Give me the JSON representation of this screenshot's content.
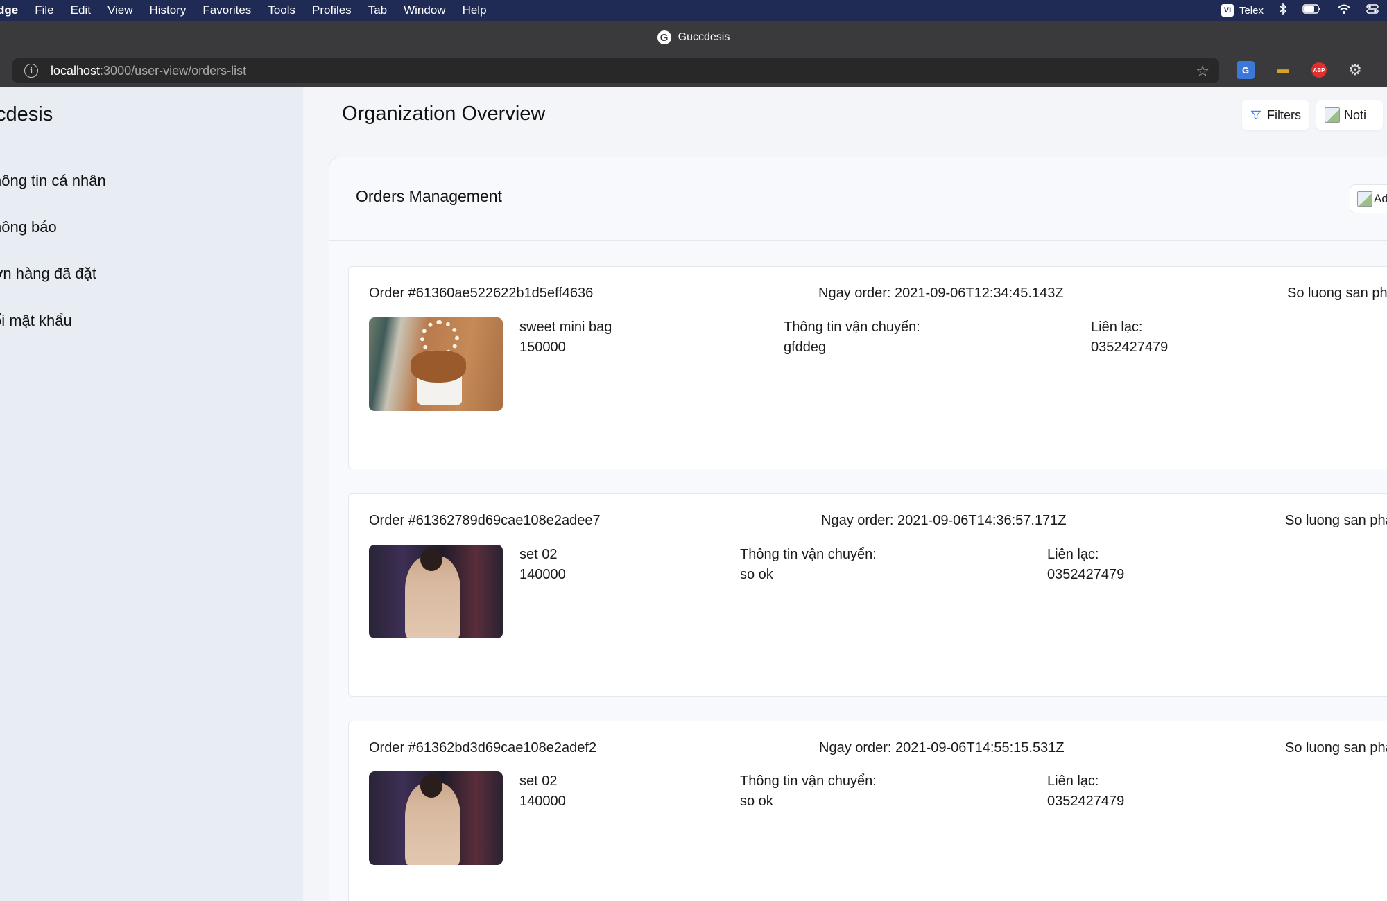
{
  "menubar": {
    "items": [
      "dge",
      "File",
      "Edit",
      "View",
      "History",
      "Favorites",
      "Tools",
      "Profiles",
      "Tab",
      "Window",
      "Help"
    ],
    "input_method": "Telex"
  },
  "browser": {
    "window_title": "Guccdesis",
    "url_host": "localhost",
    "url_path": ":3000/user-view/orders-list"
  },
  "sidebar": {
    "brand": "cdesis",
    "items": [
      {
        "label": "hông tin cá nhân"
      },
      {
        "label": "hông báo"
      },
      {
        "label": "ơn hàng đã đặt"
      },
      {
        "label": "ổi mật khẩu"
      }
    ]
  },
  "header": {
    "title": "Organization Overview",
    "filters_label": "Filters",
    "noti_label": "Noti"
  },
  "orders_panel": {
    "title": "Orders Management",
    "add_label": "Ad"
  },
  "orders": [
    {
      "id": "Order #61360ae522622b1d5eff4636",
      "date": "Ngay order: 2021-09-06T12:34:45.143Z",
      "qty_label": "So luong san pha",
      "product_name": "sweet mini bag",
      "price": "150000",
      "shipping_label": "Thông tin vận chuyển:",
      "shipping": "gfddeg",
      "contact_label": "Liên lạc:",
      "contact": "0352427479",
      "image": "handbag"
    },
    {
      "id": "Order #61362789d69cae108e2adee7",
      "date": "Ngay order: 2021-09-06T14:36:57.171Z",
      "qty_label": "So luong san pha",
      "product_name": "set 02",
      "price": "140000",
      "shipping_label": "Thông tin vận chuyển:",
      "shipping": "so ok",
      "contact_label": "Liên lạc:",
      "contact": "0352427479",
      "image": "dress"
    },
    {
      "id": "Order #61362bd3d69cae108e2adef2",
      "date": "Ngay order: 2021-09-06T14:55:15.531Z",
      "qty_label": "So luong san pha",
      "product_name": "set 02",
      "price": "140000",
      "shipping_label": "Thông tin vận chuyển:",
      "shipping": "so ok",
      "contact_label": "Liên lạc:",
      "contact": "0352427479",
      "image": "dress"
    }
  ]
}
